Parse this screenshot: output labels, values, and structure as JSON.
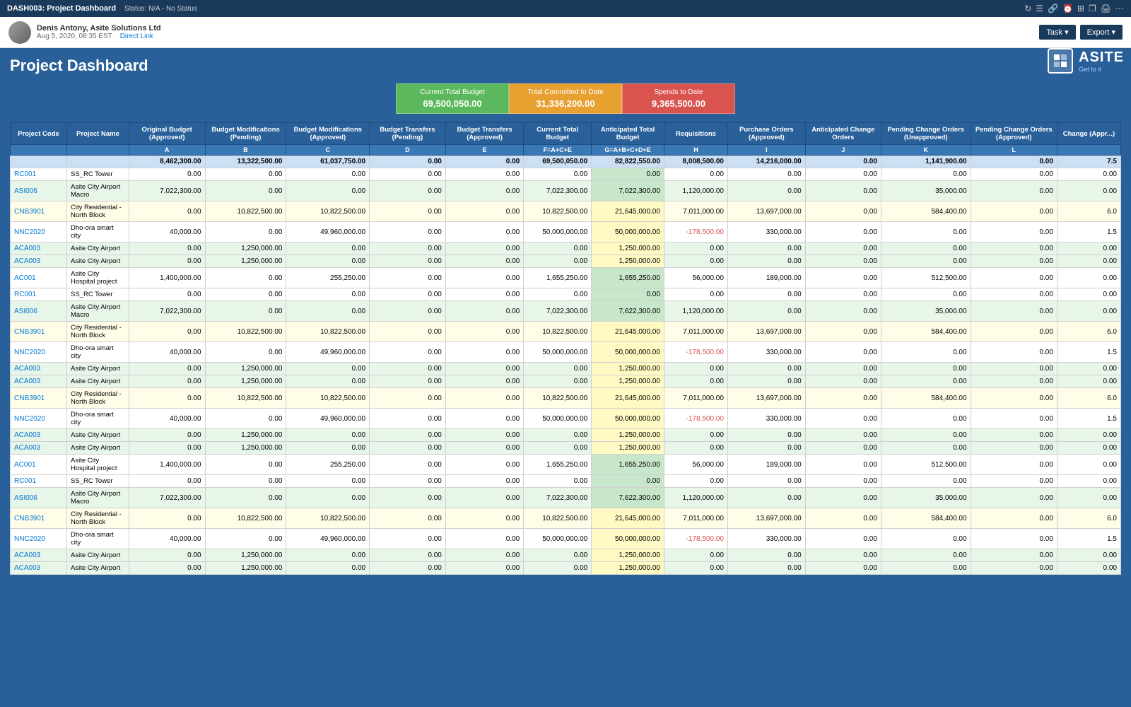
{
  "topbar": {
    "title": "DASH003: Project Dashboard",
    "status": "Status: N/A - No Status"
  },
  "userbar": {
    "name": "Denis Antony, Asite Solutions Ltd",
    "date": "Aug 5, 2020, 08:35 EST",
    "link": "Direct Link",
    "task_btn": "Task ▾",
    "export_btn": "Export ▾"
  },
  "logo": {
    "name": "ASITE",
    "tagline": "Get to it"
  },
  "page_title": "Project Dashboard",
  "summary": {
    "cards": [
      {
        "label": "Current Total Budget",
        "value": "69,500,050.00",
        "color": "green"
      },
      {
        "label": "Total Committed to Date",
        "value": "31,336,200.00",
        "color": "orange"
      },
      {
        "label": "Spends to Date",
        "value": "9,365,500.00",
        "color": "red"
      }
    ]
  },
  "table": {
    "columns": [
      {
        "label": "Project Code",
        "letter": ""
      },
      {
        "label": "Project Name",
        "letter": ""
      },
      {
        "label": "Original Budget (Approved)",
        "letter": "A"
      },
      {
        "label": "Budget Modifications (Pending)",
        "letter": "B"
      },
      {
        "label": "Budget Modifications (Approved)",
        "letter": "C"
      },
      {
        "label": "Budget Transfers (Pending)",
        "letter": "D"
      },
      {
        "label": "Budget Transfers (Approved)",
        "letter": "E"
      },
      {
        "label": "Current Total Budget",
        "letter": "F=A+C+E"
      },
      {
        "label": "Anticipated Total Budget",
        "letter": "G=A+B+C+D+E"
      },
      {
        "label": "Requisitions",
        "letter": "H"
      },
      {
        "label": "Purchase Orders (Approved)",
        "letter": "I"
      },
      {
        "label": "Anticipated Change Orders",
        "letter": "J"
      },
      {
        "label": "Pending Change Orders (Unapproved)",
        "letter": "K"
      },
      {
        "label": "Pending Change Orders (Approved)",
        "letter": "L"
      },
      {
        "label": "Change (Appr...)",
        "letter": ""
      }
    ],
    "total_row": {
      "code": "",
      "name": "",
      "values": [
        "8,462,300.00",
        "13,322,500.00",
        "61,037,750.00",
        "0.00",
        "0.00",
        "69,500,050.00",
        "82,822,550.00",
        "8,008,500.00",
        "14,216,000.00",
        "0.00",
        "1,141,900.00",
        "0.00",
        "7.5"
      ]
    },
    "rows": [
      {
        "code": "RC001",
        "name": "SS_RC Tower",
        "values": [
          "0.00",
          "0.00",
          "0.00",
          "0.00",
          "0.00",
          "0.00",
          "0.00",
          "0.00",
          "0.00",
          "0.00",
          "0.00",
          "0.00",
          "0.00"
        ],
        "style": "white",
        "atb": "green"
      },
      {
        "code": "ASI006",
        "name": "Asite City Airport Macro",
        "values": [
          "7,022,300.00",
          "0.00",
          "0.00",
          "0.00",
          "0.00",
          "7,022,300.00",
          "7,022,300.00",
          "1,120,000.00",
          "0.00",
          "0.00",
          "35,000.00",
          "0.00",
          "0.00"
        ],
        "style": "light-green",
        "atb": "green"
      },
      {
        "code": "CNB3901",
        "name": "City Residential - North Block",
        "values": [
          "0.00",
          "10,822,500.00",
          "10,822,500.00",
          "0.00",
          "0.00",
          "10,822,500.00",
          "21,645,000.00",
          "7,011,000.00",
          "13,697,000.00",
          "0.00",
          "584,400.00",
          "0.00",
          "6.0"
        ],
        "style": "yellow",
        "atb": "yellow"
      },
      {
        "code": "NNC2020",
        "name": "Dho-ora smart city",
        "values": [
          "40,000.00",
          "0.00",
          "49,960,000.00",
          "0.00",
          "0.00",
          "50,000,000.00",
          "50,000,000.00",
          "-178,500.00",
          "330,000.00",
          "0.00",
          "0.00",
          "0.00",
          "1.5"
        ],
        "style": "white",
        "atb": "yellow",
        "neg": 7
      },
      {
        "code": "ACA003",
        "name": "Asite City Airport",
        "values": [
          "0.00",
          "1,250,000.00",
          "0.00",
          "0.00",
          "0.00",
          "0.00",
          "1,250,000.00",
          "0.00",
          "0.00",
          "0.00",
          "0.00",
          "0.00",
          "0.00"
        ],
        "style": "light-green",
        "atb": "yellow"
      },
      {
        "code": "ACA003",
        "name": "Asite City Airport",
        "values": [
          "0.00",
          "1,250,000.00",
          "0.00",
          "0.00",
          "0.00",
          "0.00",
          "1,250,000.00",
          "0.00",
          "0.00",
          "0.00",
          "0.00",
          "0.00",
          "0.00"
        ],
        "style": "light-green",
        "atb": "yellow"
      },
      {
        "code": "AC001",
        "name": "Asite City Hospital project",
        "values": [
          "1,400,000.00",
          "0.00",
          "255,250.00",
          "0.00",
          "0.00",
          "1,655,250.00",
          "1,655,250.00",
          "56,000.00",
          "189,000.00",
          "0.00",
          "512,500.00",
          "0.00",
          "0.00"
        ],
        "style": "white",
        "atb": "green"
      },
      {
        "code": "RC001",
        "name": "SS_RC Tower",
        "values": [
          "0.00",
          "0.00",
          "0.00",
          "0.00",
          "0.00",
          "0.00",
          "0.00",
          "0.00",
          "0.00",
          "0.00",
          "0.00",
          "0.00",
          "0.00"
        ],
        "style": "white",
        "atb": "green"
      },
      {
        "code": "ASI006",
        "name": "Asite City Airport Macro",
        "values": [
          "7,022,300.00",
          "0.00",
          "0.00",
          "0.00",
          "0.00",
          "7,022,300.00",
          "7,622,300.00",
          "1,120,000.00",
          "0.00",
          "0.00",
          "35,000.00",
          "0.00",
          "0.00"
        ],
        "style": "light-green",
        "atb": "green"
      },
      {
        "code": "CNB3901",
        "name": "City Residential - North Block",
        "values": [
          "0.00",
          "10,822,500.00",
          "10,822,500.00",
          "0.00",
          "0.00",
          "10,822,500.00",
          "21,645,000.00",
          "7,011,000.00",
          "13,697,000.00",
          "0.00",
          "584,400.00",
          "0.00",
          "6.0"
        ],
        "style": "yellow",
        "atb": "yellow"
      },
      {
        "code": "NNC2020",
        "name": "Dho-ora smart city",
        "values": [
          "40,000.00",
          "0.00",
          "49,960,000.00",
          "0.00",
          "0.00",
          "50,000,000.00",
          "50,000,000.00",
          "-178,500.00",
          "330,000.00",
          "0.00",
          "0.00",
          "0.00",
          "1.5"
        ],
        "style": "white",
        "atb": "yellow",
        "neg": 7
      },
      {
        "code": "ACA003",
        "name": "Asite City Airport",
        "values": [
          "0.00",
          "1,250,000.00",
          "0.00",
          "0.00",
          "0.00",
          "0.00",
          "1,250,000.00",
          "0.00",
          "0.00",
          "0.00",
          "0.00",
          "0.00",
          "0.00"
        ],
        "style": "light-green",
        "atb": "yellow"
      },
      {
        "code": "ACA003",
        "name": "Asite City Airport",
        "values": [
          "0.00",
          "1,250,000.00",
          "0.00",
          "0.00",
          "0.00",
          "0.00",
          "1,250,000.00",
          "0.00",
          "0.00",
          "0.00",
          "0.00",
          "0.00",
          "0.00"
        ],
        "style": "light-green",
        "atb": "yellow"
      },
      {
        "code": "CNB3901",
        "name": "City Residential - North Block",
        "values": [
          "0.00",
          "10,822,500.00",
          "10,822,500.00",
          "0.00",
          "0.00",
          "10,822,500.00",
          "21,645,000.00",
          "7,011,000.00",
          "13,697,000.00",
          "0.00",
          "584,400.00",
          "0.00",
          "6.0"
        ],
        "style": "yellow",
        "atb": "yellow"
      },
      {
        "code": "NNC2020",
        "name": "Dho-ora smart city",
        "values": [
          "40,000.00",
          "0.00",
          "49,960,000.00",
          "0.00",
          "0.00",
          "50,000,000.00",
          "50,000,000.00",
          "-178,500.00",
          "330,000.00",
          "0.00",
          "0.00",
          "0.00",
          "1.5"
        ],
        "style": "white",
        "atb": "yellow",
        "neg": 7
      },
      {
        "code": "ACA003",
        "name": "Asite City Airport",
        "values": [
          "0.00",
          "1,250,000.00",
          "0.00",
          "0.00",
          "0.00",
          "0.00",
          "1,250,000.00",
          "0.00",
          "0.00",
          "0.00",
          "0.00",
          "0.00",
          "0.00"
        ],
        "style": "light-green",
        "atb": "yellow"
      },
      {
        "code": "ACA003",
        "name": "Asite City Airport",
        "values": [
          "0.00",
          "1,250,000.00",
          "0.00",
          "0.00",
          "0.00",
          "0.00",
          "1,250,000.00",
          "0.00",
          "0.00",
          "0.00",
          "0.00",
          "0.00",
          "0.00"
        ],
        "style": "light-green",
        "atb": "yellow"
      },
      {
        "code": "AC001",
        "name": "Asite City Hospital project",
        "values": [
          "1,400,000.00",
          "0.00",
          "255,250.00",
          "0.00",
          "0.00",
          "1,655,250.00",
          "1,655,250.00",
          "56,000.00",
          "189,000.00",
          "0.00",
          "512,500.00",
          "0.00",
          "0.00"
        ],
        "style": "white",
        "atb": "green"
      },
      {
        "code": "RC001",
        "name": "SS_RC Tower",
        "values": [
          "0.00",
          "0.00",
          "0.00",
          "0.00",
          "0.00",
          "0.00",
          "0.00",
          "0.00",
          "0.00",
          "0.00",
          "0.00",
          "0.00",
          "0.00"
        ],
        "style": "white",
        "atb": "green"
      },
      {
        "code": "ASI006",
        "name": "Asite City Airport Macro",
        "values": [
          "7,022,300.00",
          "0.00",
          "0.00",
          "0.00",
          "0.00",
          "7,022,300.00",
          "7,622,300.00",
          "1,120,000.00",
          "0.00",
          "0.00",
          "35,000.00",
          "0.00",
          "0.00"
        ],
        "style": "light-green",
        "atb": "green"
      },
      {
        "code": "CNB3901",
        "name": "City Residential - North Block",
        "values": [
          "0.00",
          "10,822,500.00",
          "10,822,500.00",
          "0.00",
          "0.00",
          "10,822,500.00",
          "21,645,000.00",
          "7,011,000.00",
          "13,697,000.00",
          "0.00",
          "584,400.00",
          "0.00",
          "6.0"
        ],
        "style": "yellow",
        "atb": "yellow"
      },
      {
        "code": "NNC2020",
        "name": "Dho-ora smart city",
        "values": [
          "40,000.00",
          "0.00",
          "49,960,000.00",
          "0.00",
          "0.00",
          "50,000,000.00",
          "50,000,000.00",
          "-178,500.00",
          "330,000.00",
          "0.00",
          "0.00",
          "0.00",
          "1.5"
        ],
        "style": "white",
        "atb": "yellow",
        "neg": 7
      },
      {
        "code": "ACA003",
        "name": "Asite City Airport",
        "values": [
          "0.00",
          "1,250,000.00",
          "0.00",
          "0.00",
          "0.00",
          "0.00",
          "1,250,000.00",
          "0.00",
          "0.00",
          "0.00",
          "0.00",
          "0.00",
          "0.00"
        ],
        "style": "light-green",
        "atb": "yellow"
      },
      {
        "code": "ACA003",
        "name": "Asite City Airport",
        "values": [
          "0.00",
          "1,250,000.00",
          "0.00",
          "0.00",
          "0.00",
          "0.00",
          "1,250,000.00",
          "0.00",
          "0.00",
          "0.00",
          "0.00",
          "0.00",
          "0.00"
        ],
        "style": "light-green",
        "atb": "yellow"
      }
    ]
  }
}
